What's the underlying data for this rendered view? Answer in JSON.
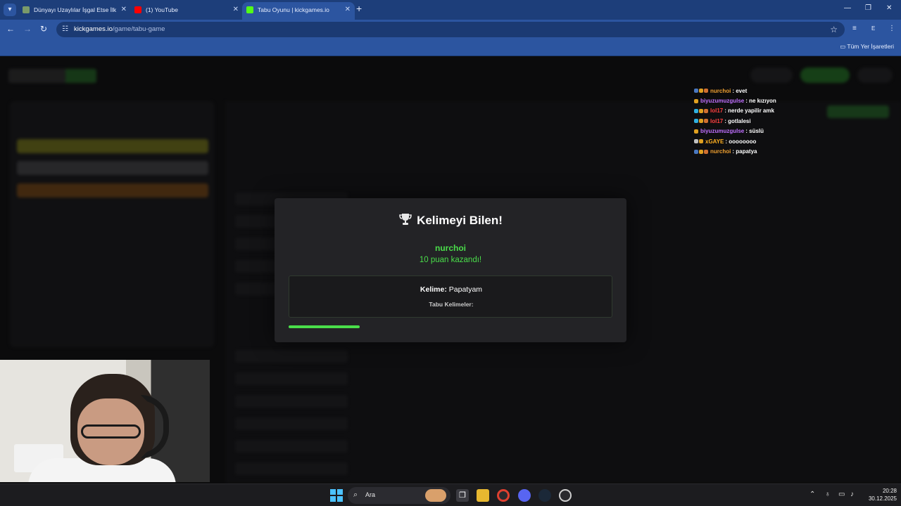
{
  "browser": {
    "tabs": [
      {
        "title": "Dünyayı Uzaylılar İşgal Etse İlk",
        "favicon_color": "#7a9a6a",
        "active": false
      },
      {
        "title": "(1) YouTube",
        "favicon_color": "#ff0000",
        "active": false
      },
      {
        "title": "Tabu Oyunu | kickgames.io",
        "favicon_color": "#53fc18",
        "active": true
      }
    ],
    "url_host": "kickgames.io",
    "url_path": "/game/tabu-game",
    "profile_initial": "E",
    "bookmarks_folder": "Tüm Yer İşaretleri"
  },
  "chat": [
    {
      "user": "nurchoi",
      "message": "evet",
      "user_color": "#f0a030"
    },
    {
      "user": "biyuzumuzgulse",
      "message": "ne kızıyon",
      "user_color": "#c070ff"
    },
    {
      "user": "lol17",
      "message": "nerde yapilir amk",
      "user_color": "#ff4040"
    },
    {
      "user": "lol17",
      "message": "gotlalesi",
      "user_color": "#ff4040"
    },
    {
      "user": "biyuzumuzgulse",
      "message": "süslü",
      "user_color": "#c070ff"
    },
    {
      "user": "xGAYE",
      "message": "oooooooo",
      "user_color": "#ffb020"
    },
    {
      "user": "nurchoi",
      "message": "papatya",
      "user_color": "#f0a030"
    }
  ],
  "modal": {
    "title": "Kelimeyi Bilen!",
    "winner": "nurchoi",
    "points_text": "10 puan kazandı!",
    "word_label": "Kelime:",
    "word": "Papatyam",
    "taboo_label": "Tabu Kelimeler:",
    "progress": 0.22,
    "accent": "#4ade4a"
  },
  "taskbar": {
    "search_placeholder": "Ara",
    "time": "20:28",
    "date": "30.12.2025"
  }
}
